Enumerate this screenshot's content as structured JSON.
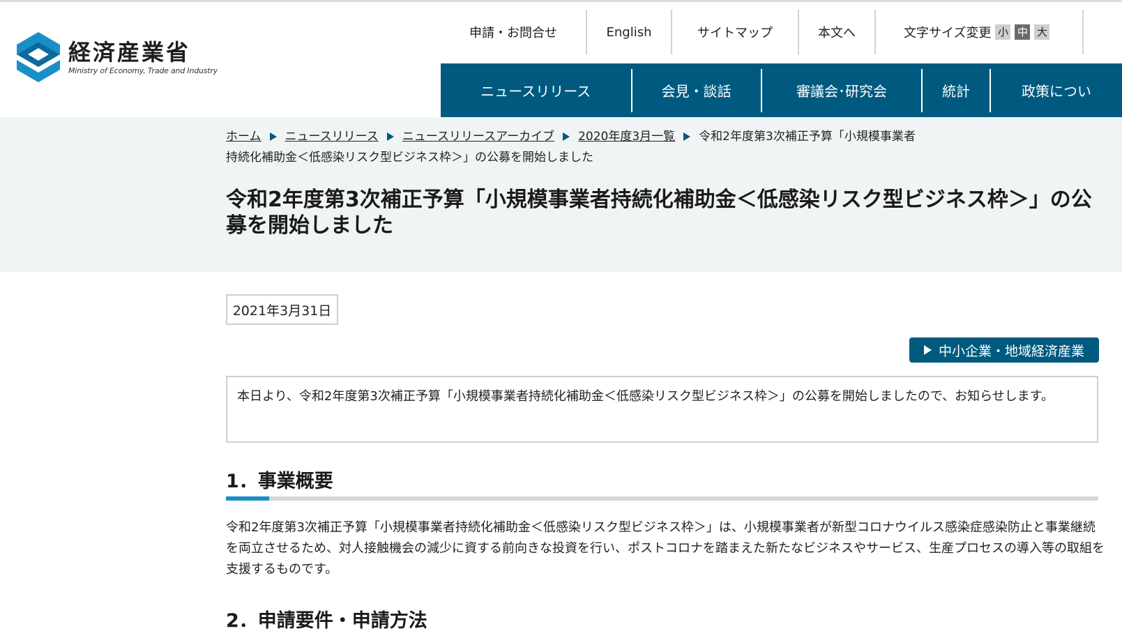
{
  "logo": {
    "ja": "経済産業省",
    "en": "Ministry of Economy, Trade and Industry"
  },
  "utility": {
    "inquiry": "申請・お問合せ",
    "english": "English",
    "sitemap": "サイトマップ",
    "to_body": "本文へ",
    "font_size_label": "文字サイズ変更",
    "size_small": "小",
    "size_medium": "中",
    "size_large": "大"
  },
  "nav": {
    "items": [
      "ニュースリリース",
      "会見・談話",
      "審議会･研究会",
      "統計",
      "政策につい"
    ]
  },
  "breadcrumb": {
    "home": "ホーム",
    "news": "ニュースリリース",
    "archive": "ニュースリリースアーカイブ",
    "month": "2020年度3月一覧",
    "current": "令和2年度第3次補正予算「小規模事業者持続化補助金＜低感染リスク型ビジネス枠＞」の公募を開始しました"
  },
  "page": {
    "title": "令和2年度第3次補正予算「小規模事業者持続化補助金＜低感染リスク型ビジネス枠＞」の公募を開始しました",
    "date": "2021年3月31日",
    "category": "中小企業・地域経済産業",
    "lead": "本日より、令和2年度第3次補正予算「小規模事業者持続化補助金＜低感染リスク型ビジネス枠＞」の公募を開始しましたので、お知らせします。",
    "section1_title": "1．事業概要",
    "section1_body": "令和2年度第3次補正予算「小規模事業者持続化補助金＜低感染リスク型ビジネス枠＞」は、小規模事業者が新型コロナウイルス感染症感染防止と事業継続を両立させるため、対人接触機会の減少に資する前向きな投資を行い、ポストコロナを踏まえた新たなビジネスやサービス、生産プロセスの導入等の取組を支援するものです。",
    "section2_title": "2．申請要件・申請方法"
  },
  "colors": {
    "brand": "#005a7f",
    "accent": "#1a8fc7",
    "band_bg": "#f0f4f4"
  }
}
